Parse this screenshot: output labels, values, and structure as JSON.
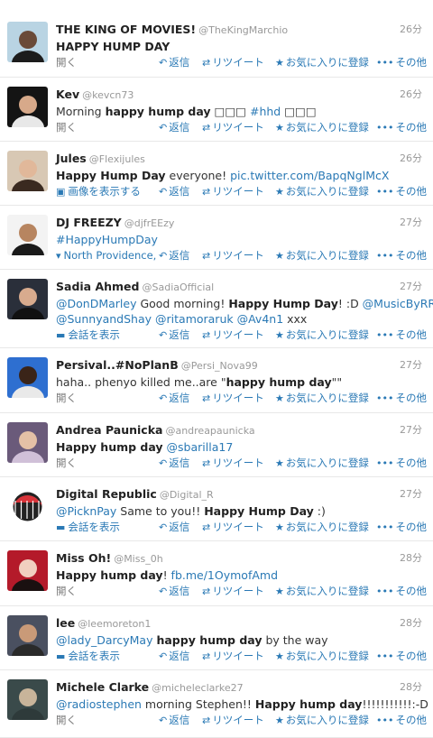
{
  "actions": {
    "reply": "返信",
    "retweet": "リツイート",
    "favorite": "お気に入りに登録",
    "more": "その他"
  },
  "tweets": [
    {
      "fullname": "THE KING OF MOVIES!",
      "username": "@TheKingMarchio",
      "time": "26分",
      "text": [
        {
          "t": "HAPPY HUMP DAY",
          "b": true
        }
      ],
      "lead": "開く",
      "lead_icon": "",
      "avatar_icon": "profile-photo-icon"
    },
    {
      "fullname": "Kev",
      "username": "@kevcn73",
      "time": "26分",
      "text": [
        {
          "t": "Morning "
        },
        {
          "t": "happy hump day",
          "b": true
        },
        {
          "t": " □□□ "
        },
        {
          "t": "#hhd",
          "l": true
        },
        {
          "t": " □□□"
        }
      ],
      "lead": "開く",
      "lead_icon": "",
      "avatar_icon": "profile-photo-icon"
    },
    {
      "fullname": "Jules",
      "username": "@Flexijules",
      "time": "26分",
      "text": [
        {
          "t": "Happy Hump Day",
          "b": true
        },
        {
          "t": " everyone! "
        },
        {
          "t": "pic.twitter.com/BapqNglMcX",
          "l": true
        }
      ],
      "lead": "画像を表示する",
      "lead_icon": "image-icon",
      "avatar_icon": "profile-photo-icon"
    },
    {
      "fullname": "DJ FREEZY",
      "username": "@djfrEEzy",
      "time": "27分",
      "text": [
        {
          "t": "#HappyHumpDay",
          "l": true
        }
      ],
      "lead": "North Providence,",
      "lead_icon": "location-pin-icon",
      "avatar_icon": "profile-photo-icon"
    },
    {
      "fullname": "Sadia Ahmed",
      "username": "@SadiaOfficial",
      "time": "27分",
      "text": [
        {
          "t": "@DonDMarley",
          "l": true
        },
        {
          "t": " Good morning! "
        },
        {
          "t": "Happy Hump Day",
          "b": true
        },
        {
          "t": "! :D "
        },
        {
          "t": "@MusicByRR",
          "l": true
        }
      ],
      "text2": [
        {
          "t": "@SunnyandShay",
          "l": true
        },
        {
          "t": " "
        },
        {
          "t": "@ritamoraruk",
          "l": true
        },
        {
          "t": " "
        },
        {
          "t": "@Av4n1",
          "l": true
        },
        {
          "t": " xxx"
        }
      ],
      "lead": "会話を表示",
      "lead_icon": "conversation-icon",
      "avatar_icon": "profile-photo-icon"
    },
    {
      "fullname": "Persival..#NoPlanB",
      "username": "@Persi_Nova99",
      "time": "27分",
      "text": [
        {
          "t": "haha.. phenyo killed me..are \""
        },
        {
          "t": "happy hump day",
          "b": true
        },
        {
          "t": "\"\""
        }
      ],
      "lead": "開く",
      "lead_icon": "",
      "avatar_icon": "profile-photo-icon"
    },
    {
      "fullname": "Andrea Paunicka",
      "username": "@andreapaunicka",
      "time": "27分",
      "text": [
        {
          "t": "Happy hump day",
          "b": true
        },
        {
          "t": " "
        },
        {
          "t": "@sbarilla17",
          "l": true
        }
      ],
      "lead": "開く",
      "lead_icon": "",
      "avatar_icon": "profile-photo-icon"
    },
    {
      "fullname": "Digital Republic",
      "username": "@Digital_R",
      "time": "27分",
      "text": [
        {
          "t": "@PicknPay",
          "l": true
        },
        {
          "t": " Same to you!! "
        },
        {
          "t": "Happy Hump Day",
          "b": true
        },
        {
          "t": " :)"
        }
      ],
      "lead": "会話を表示",
      "lead_icon": "conversation-icon",
      "avatar_icon": "globe-logo-icon"
    },
    {
      "fullname": "Miss Oh!",
      "username": "@Miss_0h",
      "time": "28分",
      "text": [
        {
          "t": "Happy hump day",
          "b": true
        },
        {
          "t": "! "
        },
        {
          "t": "fb.me/1OymofAmd",
          "l": true
        }
      ],
      "lead": "開く",
      "lead_icon": "",
      "avatar_icon": "profile-photo-icon"
    },
    {
      "fullname": "lee",
      "username": "@leemoreton1",
      "time": "28分",
      "text": [
        {
          "t": "@lady_DarcyMay",
          "l": true
        },
        {
          "t": " "
        },
        {
          "t": "happy hump day",
          "b": true
        },
        {
          "t": " by the way"
        }
      ],
      "lead": "会話を表示",
      "lead_icon": "conversation-icon",
      "avatar_icon": "profile-photo-icon"
    },
    {
      "fullname": "Michele Clarke",
      "username": "@micheleclarke27",
      "time": "28分",
      "text": [
        {
          "t": "@radiostephen",
          "l": true
        },
        {
          "t": " morning Stephen!! "
        },
        {
          "t": "Happy hump day",
          "b": true
        },
        {
          "t": "!!!!!!!!!!!:-D"
        }
      ],
      "lead": "開く",
      "lead_icon": "",
      "avatar_icon": "profile-photo-icon"
    }
  ]
}
